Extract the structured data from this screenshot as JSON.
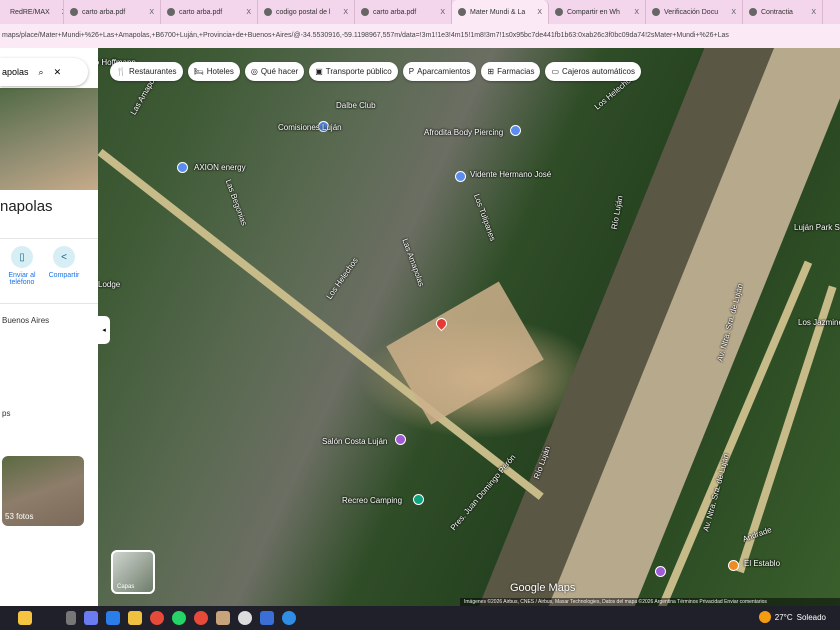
{
  "tabs": [
    {
      "title": "RedRE/MAX",
      "icon": "remax-icon"
    },
    {
      "title": "carto arba.pdf",
      "icon": "pdf-icon"
    },
    {
      "title": "carto arba.pdf",
      "icon": "pdf-icon"
    },
    {
      "title": "codigo postal de l",
      "icon": "google-icon"
    },
    {
      "title": "carto arba.pdf",
      "icon": "pdf-icon"
    },
    {
      "title": "Mater Mundi & La",
      "icon": "maps-icon",
      "active": true
    },
    {
      "title": "Compartir en Wh",
      "icon": "globe-icon"
    },
    {
      "title": "Verificación Docu",
      "icon": "gmail-icon"
    },
    {
      "title": "Contractia",
      "icon": "contractia-icon"
    }
  ],
  "tab_close": "X",
  "url": "maps/place/Mater+Mundi+%26+Las+Amapolas,+B6700+Luján,+Provincia+de+Buenos+Aires/@-34.5530916,-59.1198967,557m/data=!3m1!1e3!4m15!1m8!3m7!1s0x95bc7de441fb1b63:0xab26c3f0bc09da74!2sMater+Mundi+%26+Las",
  "search": {
    "value": "apolas"
  },
  "chips": [
    {
      "label": "Restaurantes",
      "icon": "fork-knife-icon",
      "glyph": "🍴"
    },
    {
      "label": "Hoteles",
      "icon": "bed-icon",
      "glyph": "🛏"
    },
    {
      "label": "Qué hacer",
      "icon": "camera-icon",
      "glyph": "◎"
    },
    {
      "label": "Transporte público",
      "icon": "bus-icon",
      "glyph": "▣"
    },
    {
      "label": "Aparcamientos",
      "icon": "parking-icon",
      "glyph": "P"
    },
    {
      "label": "Farmacias",
      "icon": "pharmacy-icon",
      "glyph": "⊞"
    },
    {
      "label": "Cajeros automáticos",
      "icon": "atm-icon",
      "glyph": "▭"
    }
  ],
  "panel": {
    "title": "napolas",
    "actions": [
      {
        "label": "Enviar al teléfono",
        "icon": "phone-icon"
      },
      {
        "label": "Compartir",
        "icon": "share-icon"
      }
    ],
    "address": "Buenos Aires",
    "maps_fragment": "ps",
    "photos": "53 fotos"
  },
  "map_labels": [
    {
      "text": "ro Hoffmann"
    },
    {
      "text": "Las Amapolas"
    },
    {
      "text": "Dalbe Club"
    },
    {
      "text": "Comisiones Luján"
    },
    {
      "text": "Afrodita Body Piercing"
    },
    {
      "text": "AXION energy"
    },
    {
      "text": "Vidente Hermano José"
    },
    {
      "text": "Los Helechos"
    },
    {
      "text": "Las Begonias"
    },
    {
      "text": "Los Helechos"
    },
    {
      "text": "Las Amapolas"
    },
    {
      "text": "Los Tulipanes"
    },
    {
      "text": "Río Luján"
    },
    {
      "text": "Luján Park S"
    },
    {
      "text": "Lodge"
    },
    {
      "text": "Av. Ntra. Sra. de Luján"
    },
    {
      "text": "Pres. Juan Domingo Perón"
    },
    {
      "text": "Salón Costa Luján"
    },
    {
      "text": "Río Luján"
    },
    {
      "text": "Recreo Camping"
    },
    {
      "text": "Av. Ntra. Sra. de Luján"
    },
    {
      "text": "Andrade"
    },
    {
      "text": "El Establo"
    },
    {
      "text": "Los Jazmines"
    }
  ],
  "layers_label": "Capas",
  "google_maps": "Google Maps",
  "attribution": "Imágenes ©2026 Airbus, CNES / Airbus, Maxar Technologies, Datos del mapa ©2026   Argentina   Términos   Privacidad   Enviar comentarios",
  "weather": {
    "temp": "27°C",
    "condition": "Soleado"
  }
}
